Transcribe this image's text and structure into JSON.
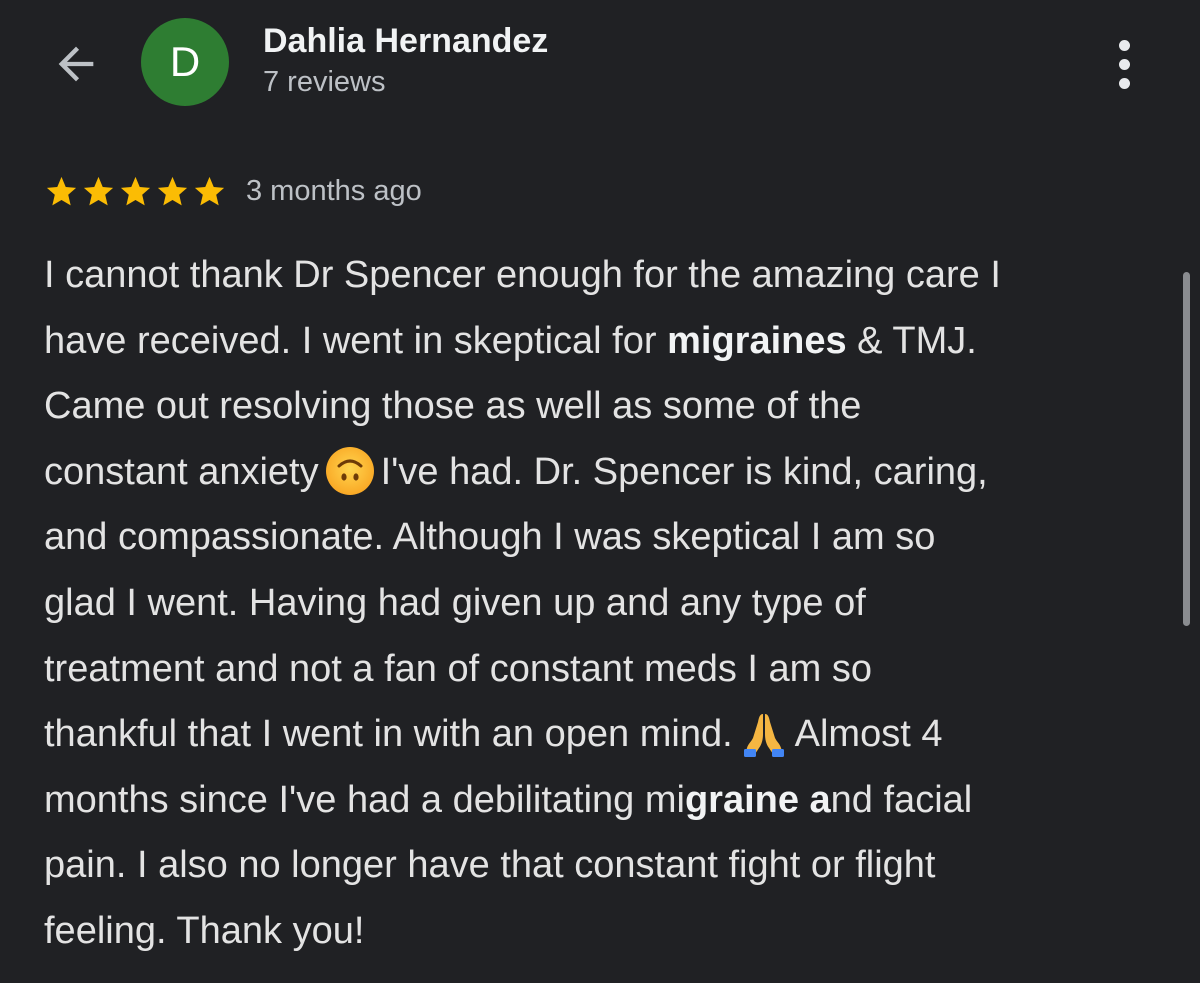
{
  "header": {
    "back_icon": "arrow-back-icon",
    "avatar_initial": "D",
    "avatar_color": "#2e7d32",
    "reviewer_name": "Dahlia Hernandez",
    "review_count": "7 reviews",
    "more_icon": "more-vert-icon"
  },
  "review": {
    "rating": 5,
    "rating_max": 5,
    "star_color": "#fbbc04",
    "date": "3 months ago",
    "lines": {
      "l1": "I cannot thank Dr Spencer enough for the amazing care I",
      "l2_a": "have received. I went in skeptical for ",
      "l2_b": "migraines",
      "l2_c": " & TMJ.",
      "l3": "Came out resolving those as well as some of the",
      "l4_a": "constant anxiety",
      "l4_b": "I've had. Dr. Spencer is kind, caring,",
      "l5": "and compassionate. Although I was skeptical I am so",
      "l6": "glad I went. Having had given up and any type of",
      "l7": "treatment and not a fan of constant meds I am so",
      "l8_a": "thankful that I went in with an open mind.",
      "l8_b": "Almost 4",
      "l9_a": "months since I've had a debilitating mi",
      "l9_b": "graine a",
      "l9_c": "nd facial",
      "l10": "pain. I also no longer have that constant fight or flight",
      "l11": "feeling. Thank you!"
    },
    "emojis": {
      "upside_down": "upside-down-face-emoji",
      "folded_hands": "folded-hands-emoji"
    }
  }
}
